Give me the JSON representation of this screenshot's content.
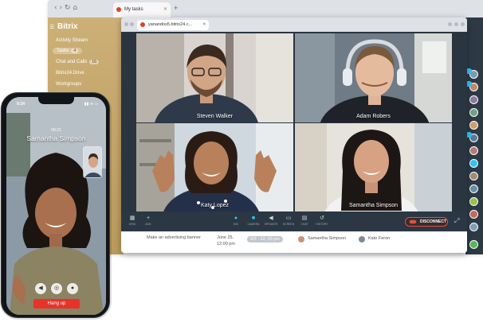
{
  "back_browser": {
    "tab_title": "My tasks",
    "new_tab_symbol": "+",
    "nav_symbols": "‹  ›  ↻  ⌂"
  },
  "bitrix": {
    "logo": "Bitrix",
    "menu": [
      {
        "label": "Activity Stream",
        "count": ""
      },
      {
        "label": "Tasks",
        "count": "4"
      },
      {
        "label": "Chat and Calls",
        "count": "16"
      },
      {
        "label": "Bitrix24.Drive",
        "count": ""
      },
      {
        "label": "Workgroups",
        "count": ""
      }
    ]
  },
  "call_window": {
    "tab_title": "yanandos5.bitrix24.c...",
    "participants": [
      {
        "name": "Steven Walker"
      },
      {
        "name": "Adam Robers"
      },
      {
        "name": "Katy Lopez"
      },
      {
        "name": "Samantha Simpson"
      }
    ],
    "toolbar": [
      {
        "icon": "grid-icon",
        "label": "GRID"
      },
      {
        "icon": "add-icon",
        "label": "ADD"
      },
      {
        "icon": "mic-icon",
        "label": "MIC"
      },
      {
        "icon": "camera-icon",
        "label": "CAMERA"
      },
      {
        "icon": "speaker-icon",
        "label": "SPEAKER"
      },
      {
        "icon": "screen-icon",
        "label": "SCREEN"
      },
      {
        "icon": "chat-icon",
        "label": "CHAT"
      },
      {
        "icon": "history-icon",
        "label": "HISTORY"
      }
    ],
    "disconnect_label": "DISCONNECT"
  },
  "task_row": {
    "title": "Make an advertising banner",
    "deadline_date": "June 25,",
    "deadline_time": "12:00 pm",
    "deadline_badge": "5/2 - 12, 03 pm",
    "created_by": "Samantha Simpson",
    "responsible": "Kate Feron"
  },
  "phone": {
    "time": "9:24",
    "status_icons": "▮▮ ≋ ▭",
    "call_timer": "00:21",
    "caller_name": "Samantha Simpson",
    "hangup_label": "Hang up"
  },
  "colors": {
    "bitrix_sidebar": "#c4a86a",
    "call_bg": "#2a3540",
    "accent_blue": "#2fc6f6",
    "disconnect_red": "#e8503d",
    "hangup_red": "#e8332b"
  }
}
